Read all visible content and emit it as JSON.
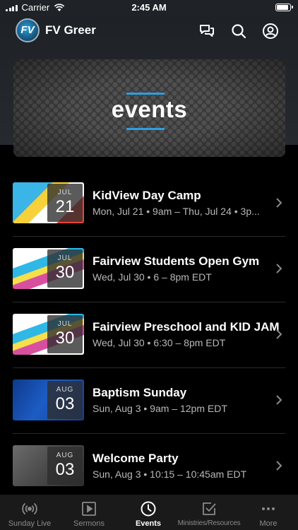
{
  "status_bar": {
    "carrier": "Carrier",
    "time": "2:45 AM"
  },
  "header": {
    "title": "FV Greer",
    "logo_text": "FV"
  },
  "banner": {
    "text": "events"
  },
  "events": [
    {
      "title": "KidView Day Camp",
      "subtitle": "Mon, Jul 21 • 9am – Thu, Jul 24 • 3p...",
      "month": "JUL",
      "day": "21"
    },
    {
      "title": "Fairview Students Open Gym",
      "subtitle": "Wed, Jul 30 • 6 – 8pm EDT",
      "month": "JUL",
      "day": "30"
    },
    {
      "title": "Fairview Preschool and KID JAM",
      "subtitle": "Wed, Jul 30 • 6:30 – 8pm EDT",
      "month": "JUL",
      "day": "30"
    },
    {
      "title": "Baptism Sunday",
      "subtitle": "Sun, Aug 3 • 9am – 12pm EDT",
      "month": "AUG",
      "day": "03"
    },
    {
      "title": "Welcome Party",
      "subtitle": "Sun, Aug 3 • 10:15 – 10:45am EDT",
      "month": "AUG",
      "day": "03"
    }
  ],
  "tabs": [
    {
      "label": "Sunday Live",
      "icon": "broadcast-icon"
    },
    {
      "label": "Sermons",
      "icon": "play-icon"
    },
    {
      "label": "Events",
      "icon": "clock-icon",
      "active": true
    },
    {
      "label": "Ministries/Resources",
      "icon": "checkbox-icon"
    },
    {
      "label": "More",
      "icon": "more-icon"
    }
  ],
  "colors": {
    "accent": "#2f9ee0",
    "background": "#000000",
    "header": "#23272b"
  }
}
